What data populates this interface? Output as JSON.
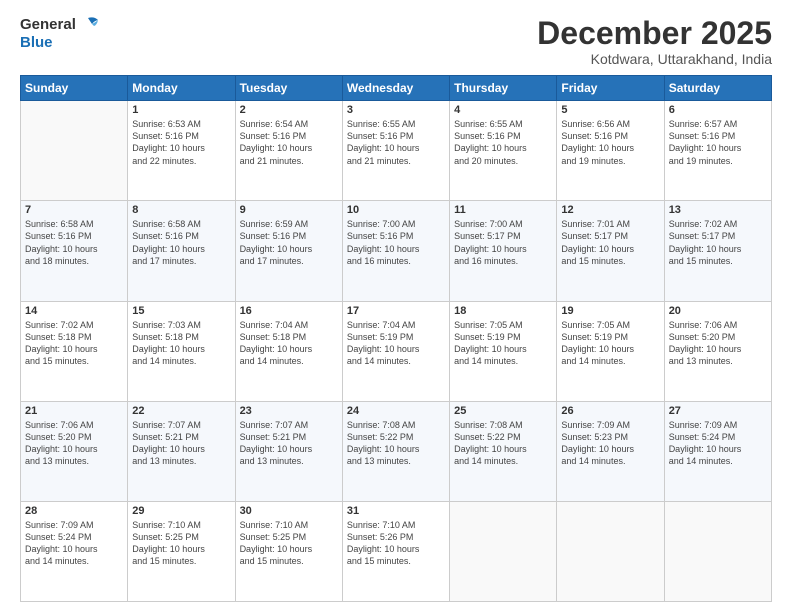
{
  "header": {
    "logo_line1": "General",
    "logo_line2": "Blue",
    "title": "December 2025",
    "subtitle": "Kotdwara, Uttarakhand, India"
  },
  "weekdays": [
    "Sunday",
    "Monday",
    "Tuesday",
    "Wednesday",
    "Thursday",
    "Friday",
    "Saturday"
  ],
  "weeks": [
    [
      {
        "day": "",
        "info": ""
      },
      {
        "day": "1",
        "info": "Sunrise: 6:53 AM\nSunset: 5:16 PM\nDaylight: 10 hours\nand 22 minutes."
      },
      {
        "day": "2",
        "info": "Sunrise: 6:54 AM\nSunset: 5:16 PM\nDaylight: 10 hours\nand 21 minutes."
      },
      {
        "day": "3",
        "info": "Sunrise: 6:55 AM\nSunset: 5:16 PM\nDaylight: 10 hours\nand 21 minutes."
      },
      {
        "day": "4",
        "info": "Sunrise: 6:55 AM\nSunset: 5:16 PM\nDaylight: 10 hours\nand 20 minutes."
      },
      {
        "day": "5",
        "info": "Sunrise: 6:56 AM\nSunset: 5:16 PM\nDaylight: 10 hours\nand 19 minutes."
      },
      {
        "day": "6",
        "info": "Sunrise: 6:57 AM\nSunset: 5:16 PM\nDaylight: 10 hours\nand 19 minutes."
      }
    ],
    [
      {
        "day": "7",
        "info": "Sunrise: 6:58 AM\nSunset: 5:16 PM\nDaylight: 10 hours\nand 18 minutes."
      },
      {
        "day": "8",
        "info": "Sunrise: 6:58 AM\nSunset: 5:16 PM\nDaylight: 10 hours\nand 17 minutes."
      },
      {
        "day": "9",
        "info": "Sunrise: 6:59 AM\nSunset: 5:16 PM\nDaylight: 10 hours\nand 17 minutes."
      },
      {
        "day": "10",
        "info": "Sunrise: 7:00 AM\nSunset: 5:16 PM\nDaylight: 10 hours\nand 16 minutes."
      },
      {
        "day": "11",
        "info": "Sunrise: 7:00 AM\nSunset: 5:17 PM\nDaylight: 10 hours\nand 16 minutes."
      },
      {
        "day": "12",
        "info": "Sunrise: 7:01 AM\nSunset: 5:17 PM\nDaylight: 10 hours\nand 15 minutes."
      },
      {
        "day": "13",
        "info": "Sunrise: 7:02 AM\nSunset: 5:17 PM\nDaylight: 10 hours\nand 15 minutes."
      }
    ],
    [
      {
        "day": "14",
        "info": "Sunrise: 7:02 AM\nSunset: 5:18 PM\nDaylight: 10 hours\nand 15 minutes."
      },
      {
        "day": "15",
        "info": "Sunrise: 7:03 AM\nSunset: 5:18 PM\nDaylight: 10 hours\nand 14 minutes."
      },
      {
        "day": "16",
        "info": "Sunrise: 7:04 AM\nSunset: 5:18 PM\nDaylight: 10 hours\nand 14 minutes."
      },
      {
        "day": "17",
        "info": "Sunrise: 7:04 AM\nSunset: 5:19 PM\nDaylight: 10 hours\nand 14 minutes."
      },
      {
        "day": "18",
        "info": "Sunrise: 7:05 AM\nSunset: 5:19 PM\nDaylight: 10 hours\nand 14 minutes."
      },
      {
        "day": "19",
        "info": "Sunrise: 7:05 AM\nSunset: 5:19 PM\nDaylight: 10 hours\nand 14 minutes."
      },
      {
        "day": "20",
        "info": "Sunrise: 7:06 AM\nSunset: 5:20 PM\nDaylight: 10 hours\nand 13 minutes."
      }
    ],
    [
      {
        "day": "21",
        "info": "Sunrise: 7:06 AM\nSunset: 5:20 PM\nDaylight: 10 hours\nand 13 minutes."
      },
      {
        "day": "22",
        "info": "Sunrise: 7:07 AM\nSunset: 5:21 PM\nDaylight: 10 hours\nand 13 minutes."
      },
      {
        "day": "23",
        "info": "Sunrise: 7:07 AM\nSunset: 5:21 PM\nDaylight: 10 hours\nand 13 minutes."
      },
      {
        "day": "24",
        "info": "Sunrise: 7:08 AM\nSunset: 5:22 PM\nDaylight: 10 hours\nand 13 minutes."
      },
      {
        "day": "25",
        "info": "Sunrise: 7:08 AM\nSunset: 5:22 PM\nDaylight: 10 hours\nand 14 minutes."
      },
      {
        "day": "26",
        "info": "Sunrise: 7:09 AM\nSunset: 5:23 PM\nDaylight: 10 hours\nand 14 minutes."
      },
      {
        "day": "27",
        "info": "Sunrise: 7:09 AM\nSunset: 5:24 PM\nDaylight: 10 hours\nand 14 minutes."
      }
    ],
    [
      {
        "day": "28",
        "info": "Sunrise: 7:09 AM\nSunset: 5:24 PM\nDaylight: 10 hours\nand 14 minutes."
      },
      {
        "day": "29",
        "info": "Sunrise: 7:10 AM\nSunset: 5:25 PM\nDaylight: 10 hours\nand 15 minutes."
      },
      {
        "day": "30",
        "info": "Sunrise: 7:10 AM\nSunset: 5:25 PM\nDaylight: 10 hours\nand 15 minutes."
      },
      {
        "day": "31",
        "info": "Sunrise: 7:10 AM\nSunset: 5:26 PM\nDaylight: 10 hours\nand 15 minutes."
      },
      {
        "day": "",
        "info": ""
      },
      {
        "day": "",
        "info": ""
      },
      {
        "day": "",
        "info": ""
      }
    ]
  ]
}
